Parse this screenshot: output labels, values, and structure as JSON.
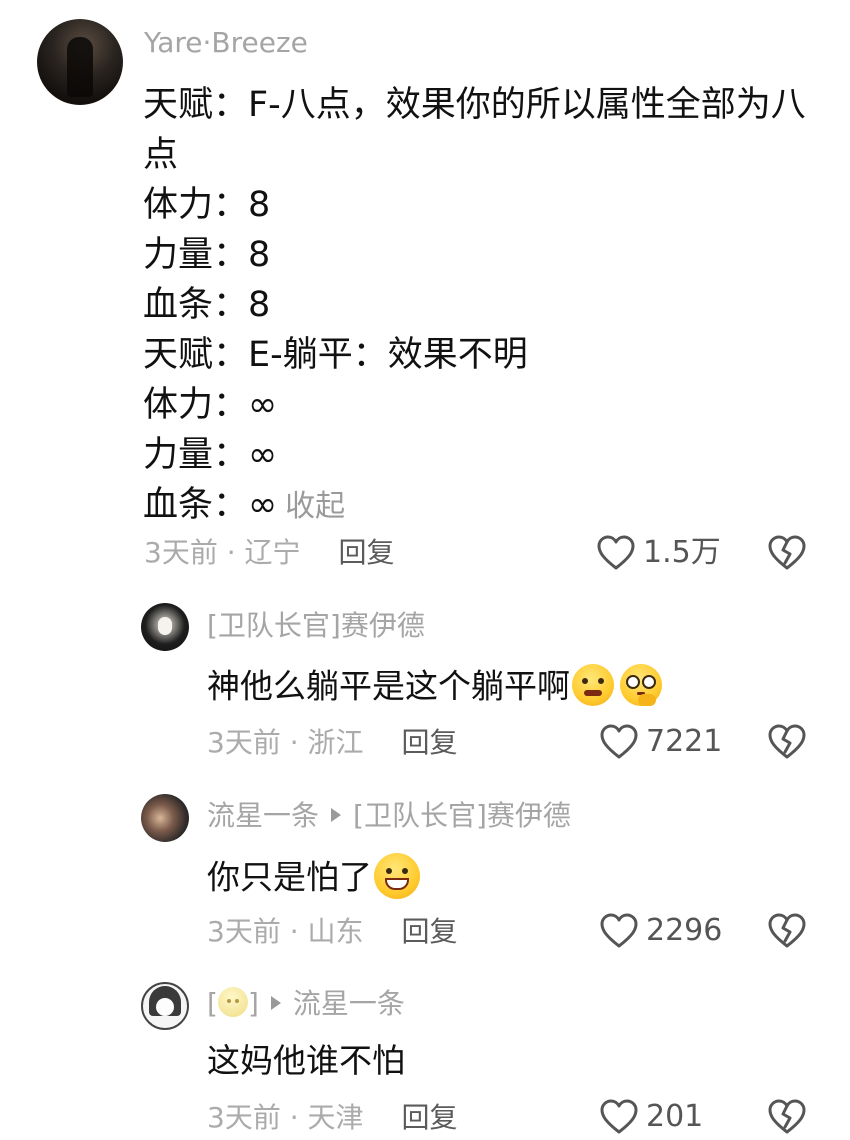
{
  "main_comment": {
    "username": "Yare·Breeze",
    "lines": [
      "天赋：F-八点，效果你的所以属性全部为八",
      "点",
      "体力：8",
      "力量：8",
      "血条：8",
      "天赋：E-躺平：效果不明",
      "体力：∞",
      "力量：∞",
      "血条：∞"
    ],
    "collapse_label": "收起",
    "time": "3天前",
    "location": "辽宁",
    "reply_label": "回复",
    "likes": "1.5万"
  },
  "replies": [
    {
      "username": "[卫队长官]赛伊德",
      "text": "神他么躺平是这个躺平啊",
      "emojis": [
        "grimace-emoji",
        "thinking-emoji"
      ],
      "time": "3天前",
      "location": "浙江",
      "reply_label": "回复",
      "likes": "7221"
    },
    {
      "username": "流星一条",
      "reply_to": "[卫队长官]赛伊德",
      "text": "你只是怕了",
      "emojis": [
        "grin-emoji"
      ],
      "time": "3天前",
      "location": "山东",
      "reply_label": "回复",
      "likes": "2296"
    },
    {
      "username_prefix": "[",
      "username_suffix": "]",
      "reply_to": "流星一条",
      "text": "这妈他谁不怕",
      "time": "3天前",
      "location": "天津",
      "reply_label": "回复",
      "likes": "201"
    }
  ],
  "meta_separator": " · ",
  "icons": {
    "like": "heart-outline-icon",
    "dislike": "broken-heart-icon",
    "reply_arrow": "triangle-right-icon"
  }
}
